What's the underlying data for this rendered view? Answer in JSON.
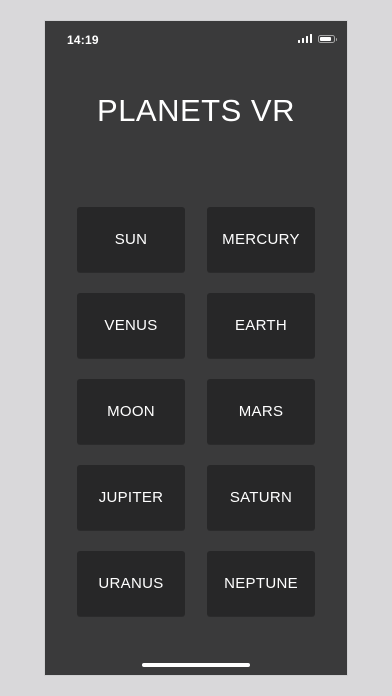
{
  "status_bar": {
    "time": "14:19",
    "icons": [
      "signal-icon",
      "battery-icon"
    ]
  },
  "app": {
    "title": "PLANETS VR"
  },
  "planets": [
    {
      "label": "SUN"
    },
    {
      "label": "MERCURY"
    },
    {
      "label": "VENUS"
    },
    {
      "label": "EARTH"
    },
    {
      "label": "MOON"
    },
    {
      "label": "MARS"
    },
    {
      "label": "JUPITER"
    },
    {
      "label": "SATURN"
    },
    {
      "label": "URANUS"
    },
    {
      "label": "NEPTUNE"
    }
  ],
  "colors": {
    "outer_background": "#d9d8da",
    "screen_background": "#3a3a3b",
    "button_background": "#272728",
    "text": "#ffffff"
  }
}
